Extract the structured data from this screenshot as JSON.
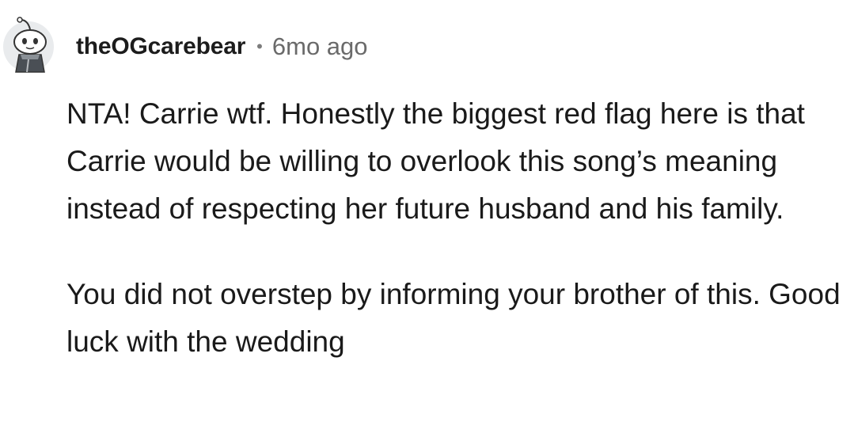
{
  "comment": {
    "author": "theOGcarebear",
    "separator": "•",
    "timestamp": "6mo ago",
    "avatar_icon": "snoo-avatar-icon",
    "paragraphs": [
      "NTA! Carrie wtf. Honestly the biggest red flag here is that Carrie would be willing to overlook this song’s meaning instead of respecting her future husband and his family.",
      "You did not overstep by informing your brother of this. Good luck with the wedding"
    ]
  }
}
